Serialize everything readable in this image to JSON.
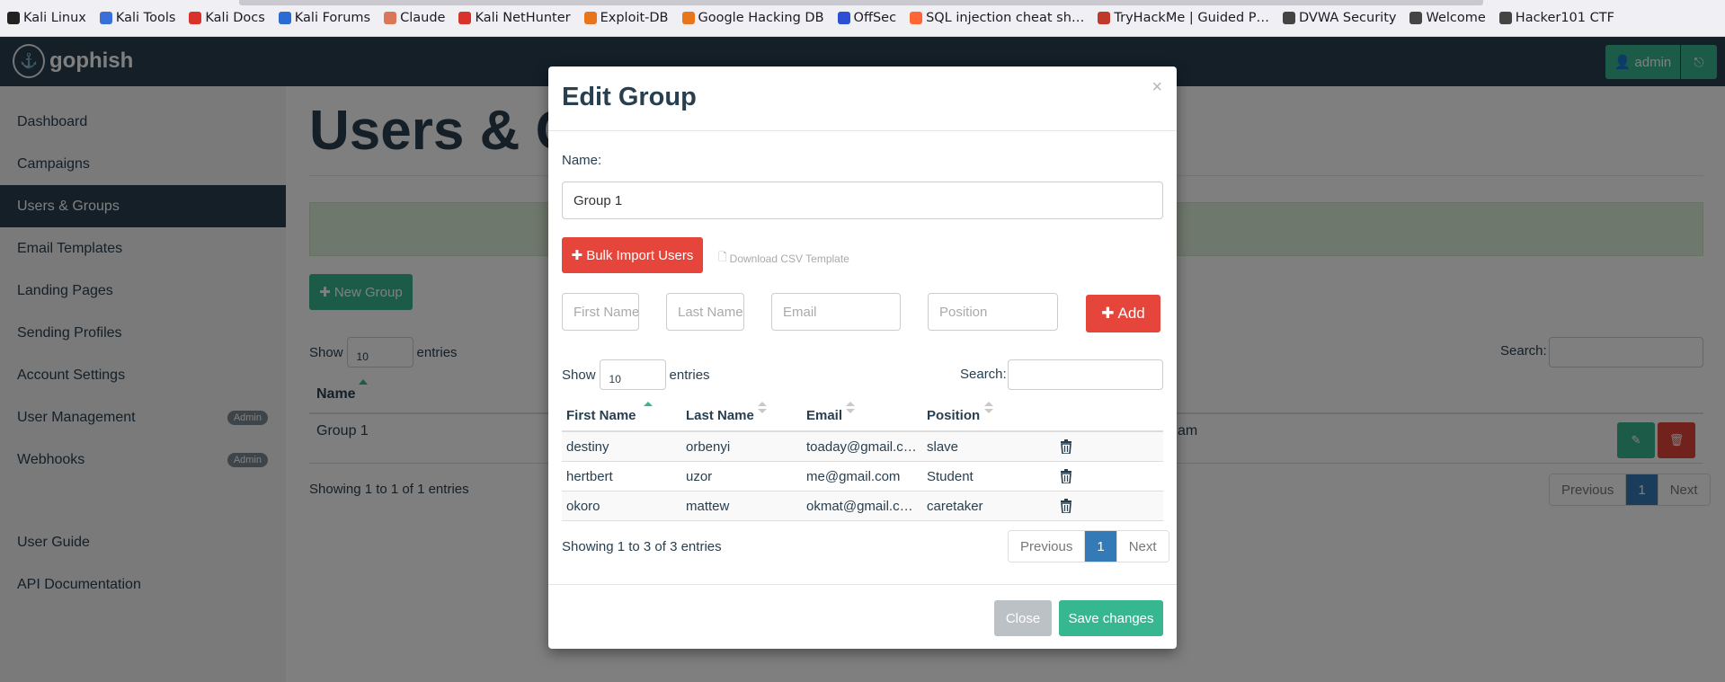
{
  "bookmarks": [
    {
      "label": "Kali Linux",
      "icon": "kali-dragon-icon",
      "color": "#222222"
    },
    {
      "label": "Kali Tools",
      "icon": "kali-tools-icon",
      "color": "#3a6fd8"
    },
    {
      "label": "Kali Docs",
      "icon": "kali-docs-icon",
      "color": "#d9322a"
    },
    {
      "label": "Kali Forums",
      "icon": "kali-forums-icon",
      "color": "#2b6cd4"
    },
    {
      "label": "Claude",
      "icon": "claude-icon",
      "color": "#d97757"
    },
    {
      "label": "Kali NetHunter",
      "icon": "nethunter-icon",
      "color": "#d9322a"
    },
    {
      "label": "Exploit-DB",
      "icon": "exploit-db-icon",
      "color": "#e8741c"
    },
    {
      "label": "Google Hacking DB",
      "icon": "ghdb-icon",
      "color": "#e8741c"
    },
    {
      "label": "OffSec",
      "icon": "offsec-icon",
      "color": "#2b50d4"
    },
    {
      "label": "SQL injection cheat sh…",
      "icon": "portswigger-icon",
      "color": "#ff6633"
    },
    {
      "label": "TryHackMe | Guided P…",
      "icon": "tryhackme-icon",
      "color": "#c0392b"
    },
    {
      "label": "DVWA Security",
      "icon": "globe-icon",
      "color": "#444444"
    },
    {
      "label": "Welcome",
      "icon": "globe-icon",
      "color": "#444444"
    },
    {
      "label": "Hacker101 CTF",
      "icon": "globe-icon",
      "color": "#444444"
    }
  ],
  "navbar": {
    "brand": "gophish",
    "admin_label": "admin"
  },
  "sidebar": {
    "items": [
      {
        "label": "Dashboard"
      },
      {
        "label": "Campaigns"
      },
      {
        "label": "Users & Groups",
        "active": true
      },
      {
        "label": "Email Templates"
      },
      {
        "label": "Landing Pages"
      },
      {
        "label": "Sending Profiles"
      },
      {
        "label": "Account Settings"
      },
      {
        "label": "User Management",
        "badge": "Admin"
      },
      {
        "label": "Webhooks",
        "badge": "Admin"
      },
      {
        "label": "User Guide"
      },
      {
        "label": "API Documentation"
      }
    ]
  },
  "main": {
    "title": "Users & G",
    "new_group_label": "New Group",
    "show_label": "Show",
    "show_value": "10",
    "entries_label": "entries",
    "search_label": "Search:",
    "col_name": "Name",
    "row_name": "Group 1",
    "row_tail": "am",
    "info": "Showing 1 to 1 of 1 entries",
    "pager": {
      "prev": "Previous",
      "page": "1",
      "next": "Next"
    }
  },
  "modal": {
    "title": "Edit Group",
    "close_x": "×",
    "name_label": "Name:",
    "name_value": "Group 1",
    "bulk_import_label": "Bulk Import Users",
    "csv_template_label": "Download CSV Template",
    "placeholders": {
      "first_name": "First Name",
      "last_name": "Last Name",
      "email": "Email",
      "position": "Position"
    },
    "add_label": "Add",
    "show_label": "Show",
    "show_value": "10",
    "entries_label": "entries",
    "search_label": "Search:",
    "columns": [
      "First Name",
      "Last Name",
      "Email",
      "Position"
    ],
    "rows": [
      {
        "first": "destiny",
        "last": "orbenyi",
        "email": "toaday@gmail.c…",
        "position": "slave"
      },
      {
        "first": "hertbert",
        "last": "uzor",
        "email": "me@gmail.com",
        "position": "Student"
      },
      {
        "first": "okoro",
        "last": "mattew",
        "email": "okmat@gmail.c…",
        "position": "caretaker"
      }
    ],
    "info": "Showing 1 to 3 of 3 entries",
    "pager": {
      "prev": "Previous",
      "page": "1",
      "next": "Next"
    },
    "close_label": "Close",
    "save_label": "Save changes"
  }
}
